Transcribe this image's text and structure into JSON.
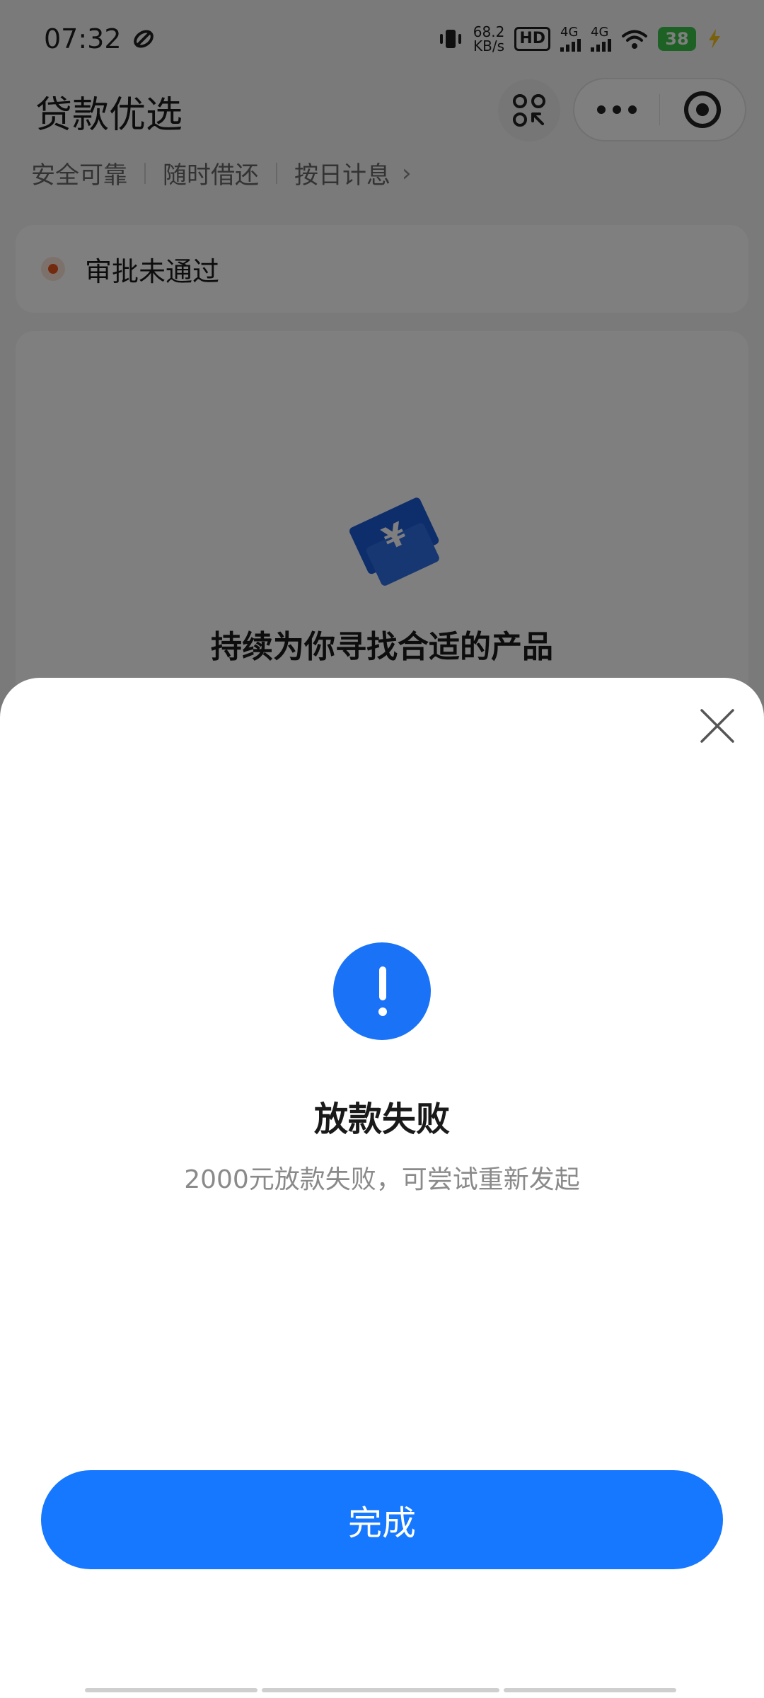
{
  "status_bar": {
    "time": "07:32",
    "net_speed_value": "68.2",
    "net_speed_unit": "KB/s",
    "hd_label": "HD",
    "signal_1_label": "4G",
    "signal_2_label": "4G",
    "battery_level": "38",
    "icons": [
      "link-icon",
      "vibrate-icon",
      "hd-voice-icon",
      "signal-icon",
      "wifi-icon",
      "battery-icon",
      "charging-icon"
    ]
  },
  "header": {
    "title": "贷款优选",
    "tags": [
      "安全可靠",
      "随时借还",
      "按日计息"
    ]
  },
  "status_card": {
    "text": "审批未通过",
    "accent_color": "#e9541f"
  },
  "main_card": {
    "message": "持续为你寻找合适的产品",
    "icon": "money-cards-icon"
  },
  "sheet": {
    "title": "放款失败",
    "description": "2000元放款失败，可尝试重新发起",
    "done_label": "完成",
    "accent_color": "#1677ff"
  }
}
